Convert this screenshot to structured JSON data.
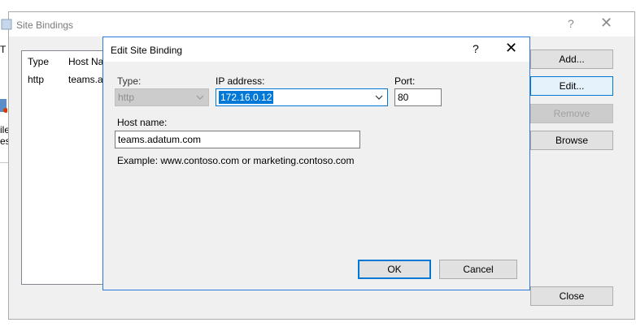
{
  "background": {
    "fragment_top": "T R",
    "fragment_left_1": "ile",
    "fragment_left_2": "est"
  },
  "site_bindings": {
    "title": "Site Bindings",
    "help_glyph": "?",
    "close_glyph": "✕",
    "columns": [
      "Type",
      "Host Na"
    ],
    "rows": [
      {
        "type": "http",
        "host": "teams.ac"
      }
    ],
    "buttons": {
      "add": "Add...",
      "edit": "Edit...",
      "remove": "Remove",
      "browse": "Browse",
      "close": "Close"
    }
  },
  "edit_binding": {
    "title": "Edit Site Binding",
    "help_glyph": "?",
    "close_glyph": "✕",
    "type_label": "Type:",
    "type_value": "http",
    "ip_label": "IP address:",
    "ip_value": "172.16.0.12",
    "port_label": "Port:",
    "port_value": "80",
    "host_label": "Host name:",
    "host_value": "teams.adatum.com",
    "example_text": "Example: www.contoso.com or marketing.contoso.com",
    "ok_label": "OK",
    "cancel_label": "Cancel"
  }
}
